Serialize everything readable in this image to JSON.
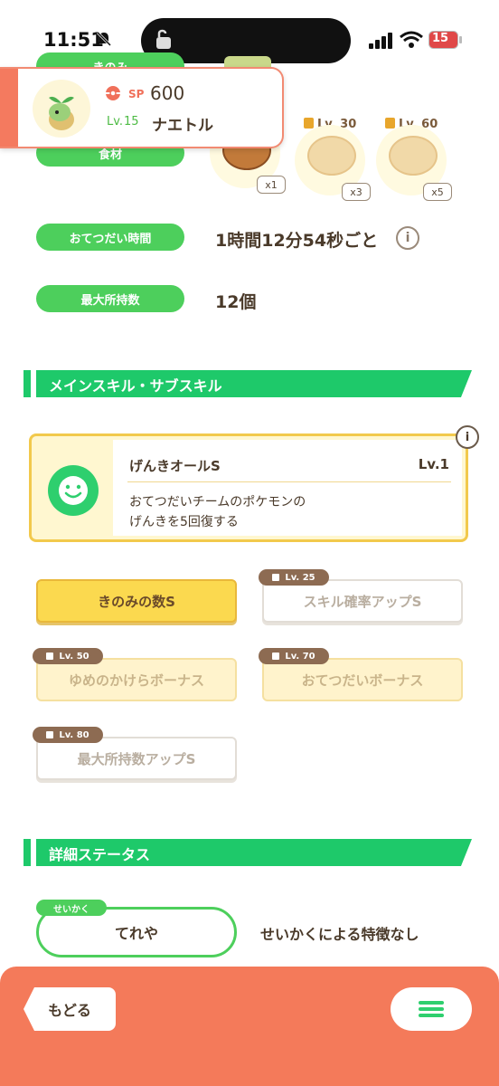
{
  "status": {
    "time": "11:51",
    "battery": "15"
  },
  "top_rows": {
    "berry_label": "きのみ",
    "ingredient_label": "食材",
    "ingredients": [
      {
        "level": "",
        "count": "x1"
      },
      {
        "level": "Lv. 30",
        "count": "x3"
      },
      {
        "level": "Lv. 60",
        "count": "x5"
      }
    ]
  },
  "pokemon": {
    "sp_label": "SP",
    "sp_value": "600",
    "level_label": "Lv.",
    "level": "15",
    "name": "ナエトル"
  },
  "stats": {
    "help_time_label": "おてつだい時間",
    "help_time_value": "1時間12分54秒ごと",
    "capacity_label": "最大所持数",
    "capacity_value": "12個"
  },
  "skills_section": {
    "title": "メインスキル・サブスキル",
    "main_skill": {
      "name": "げんきオールS",
      "level": "Lv.1",
      "description_line1": "おてつだいチームのポケモンの",
      "description_line2": "げんきを5回復する"
    },
    "sub_skills": [
      {
        "label": "きのみの数S",
        "unlock": ""
      },
      {
        "label": "スキル確率アップS",
        "unlock": "Lv. 25"
      },
      {
        "label": "ゆめのかけらボーナス",
        "unlock": "Lv. 50"
      },
      {
        "label": "おてつだいボーナス",
        "unlock": "Lv. 70"
      },
      {
        "label": "最大所持数アップS",
        "unlock": "Lv. 80"
      }
    ]
  },
  "detail_section": {
    "title": "詳細ステータス",
    "nature_tag": "せいかく",
    "nature_value": "てれや",
    "nature_effect": "せいかくによる特徴なし"
  },
  "bottom": {
    "back_label": "もどる"
  },
  "colors": {
    "accent_green": "#1ec96a",
    "accent_orange": "#f47a5a",
    "gold": "#fbd94f"
  }
}
